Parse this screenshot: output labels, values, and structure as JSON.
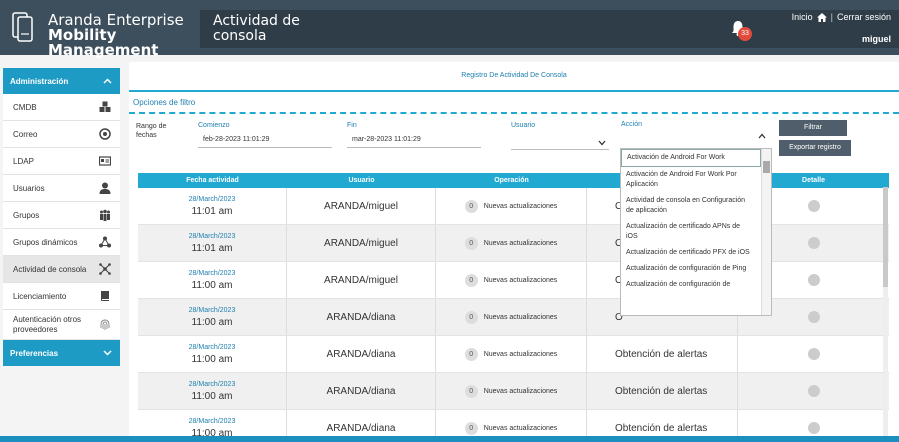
{
  "header": {
    "logo_line1": "Aranda Enterprise",
    "logo_line2": "Mobility Management",
    "title_line1": "Actividad de",
    "title_line2": "consola",
    "notification_count": "33",
    "home_link": "Inicio",
    "separator": "|",
    "logout_link": "Cerrar sesión",
    "username": "miguel"
  },
  "sidebar": {
    "admin_label": "Administración",
    "items": [
      {
        "label": "CMDB",
        "icon": "cubes-icon"
      },
      {
        "label": "Correo",
        "icon": "mail-icon"
      },
      {
        "label": "LDAP",
        "icon": "id-card-icon"
      },
      {
        "label": "Usuarios",
        "icon": "user-icon"
      },
      {
        "label": "Grupos",
        "icon": "group-icon"
      },
      {
        "label": "Grupos dinámicos",
        "icon": "network-icon"
      },
      {
        "label": "Actividad de consola",
        "icon": "activity-icon"
      },
      {
        "label": "Licenciamiento",
        "icon": "book-icon"
      },
      {
        "label": "Autenticación otros proveedores",
        "icon": "fingerprint-icon"
      }
    ],
    "prefs_label": "Preferencias"
  },
  "main": {
    "subtitle": "Registro De Actividad De Consola",
    "filter_title": "Opciones de filtro",
    "range_label": "Rango de fechas",
    "start_label": "Comienzo",
    "start_value": "feb-28-2023 11:01:29",
    "end_label": "Fin",
    "end_value": "mar-28-2023 11:01:29",
    "user_label": "Usuario",
    "action_label": "Acción",
    "filter_button": "Filtrar",
    "export_button": "Exportar registro"
  },
  "table": {
    "headers": [
      "Fecha actividad",
      "Usuario",
      "Operación",
      "Acción",
      "Detalle"
    ],
    "rows": [
      {
        "date": "28/March/2023",
        "time": "11:01 am",
        "user": "ARANDA/miguel",
        "count": "0",
        "operation": "Nuevas actualizaciones",
        "action": "O"
      },
      {
        "date": "28/March/2023",
        "time": "11:01 am",
        "user": "ARANDA/miguel",
        "count": "0",
        "operation": "Nuevas actualizaciones",
        "action": "O"
      },
      {
        "date": "28/March/2023",
        "time": "11:00 am",
        "user": "ARANDA/miguel",
        "count": "0",
        "operation": "Nuevas actualizaciones",
        "action": "O"
      },
      {
        "date": "28/March/2023",
        "time": "11:00 am",
        "user": "ARANDA/diana",
        "count": "0",
        "operation": "Nuevas actualizaciones",
        "action": "O"
      },
      {
        "date": "28/March/2023",
        "time": "11:00 am",
        "user": "ARANDA/diana",
        "count": "0",
        "operation": "Nuevas actualizaciones",
        "action": "Obtención de alertas"
      },
      {
        "date": "28/March/2023",
        "time": "11:00 am",
        "user": "ARANDA/diana",
        "count": "0",
        "operation": "Nuevas actualizaciones",
        "action": "Obtención de alertas"
      },
      {
        "date": "28/March/2023",
        "time": "11:00 am",
        "user": "ARANDA/diana",
        "count": "0",
        "operation": "Nuevas actualizaciones",
        "action": "Obtención de alertas"
      }
    ]
  },
  "dropdown": {
    "options": [
      "Activación de Android For Work",
      "Activación de Android For Work Por Aplicación",
      "Actividad de consola en Configuración de aplicación",
      "Actualización de certificado APNs de iOS",
      "Actualización de certificado PFX de iOS",
      "Actualización de configuración de Ping",
      "Actualización de configuración de"
    ]
  }
}
